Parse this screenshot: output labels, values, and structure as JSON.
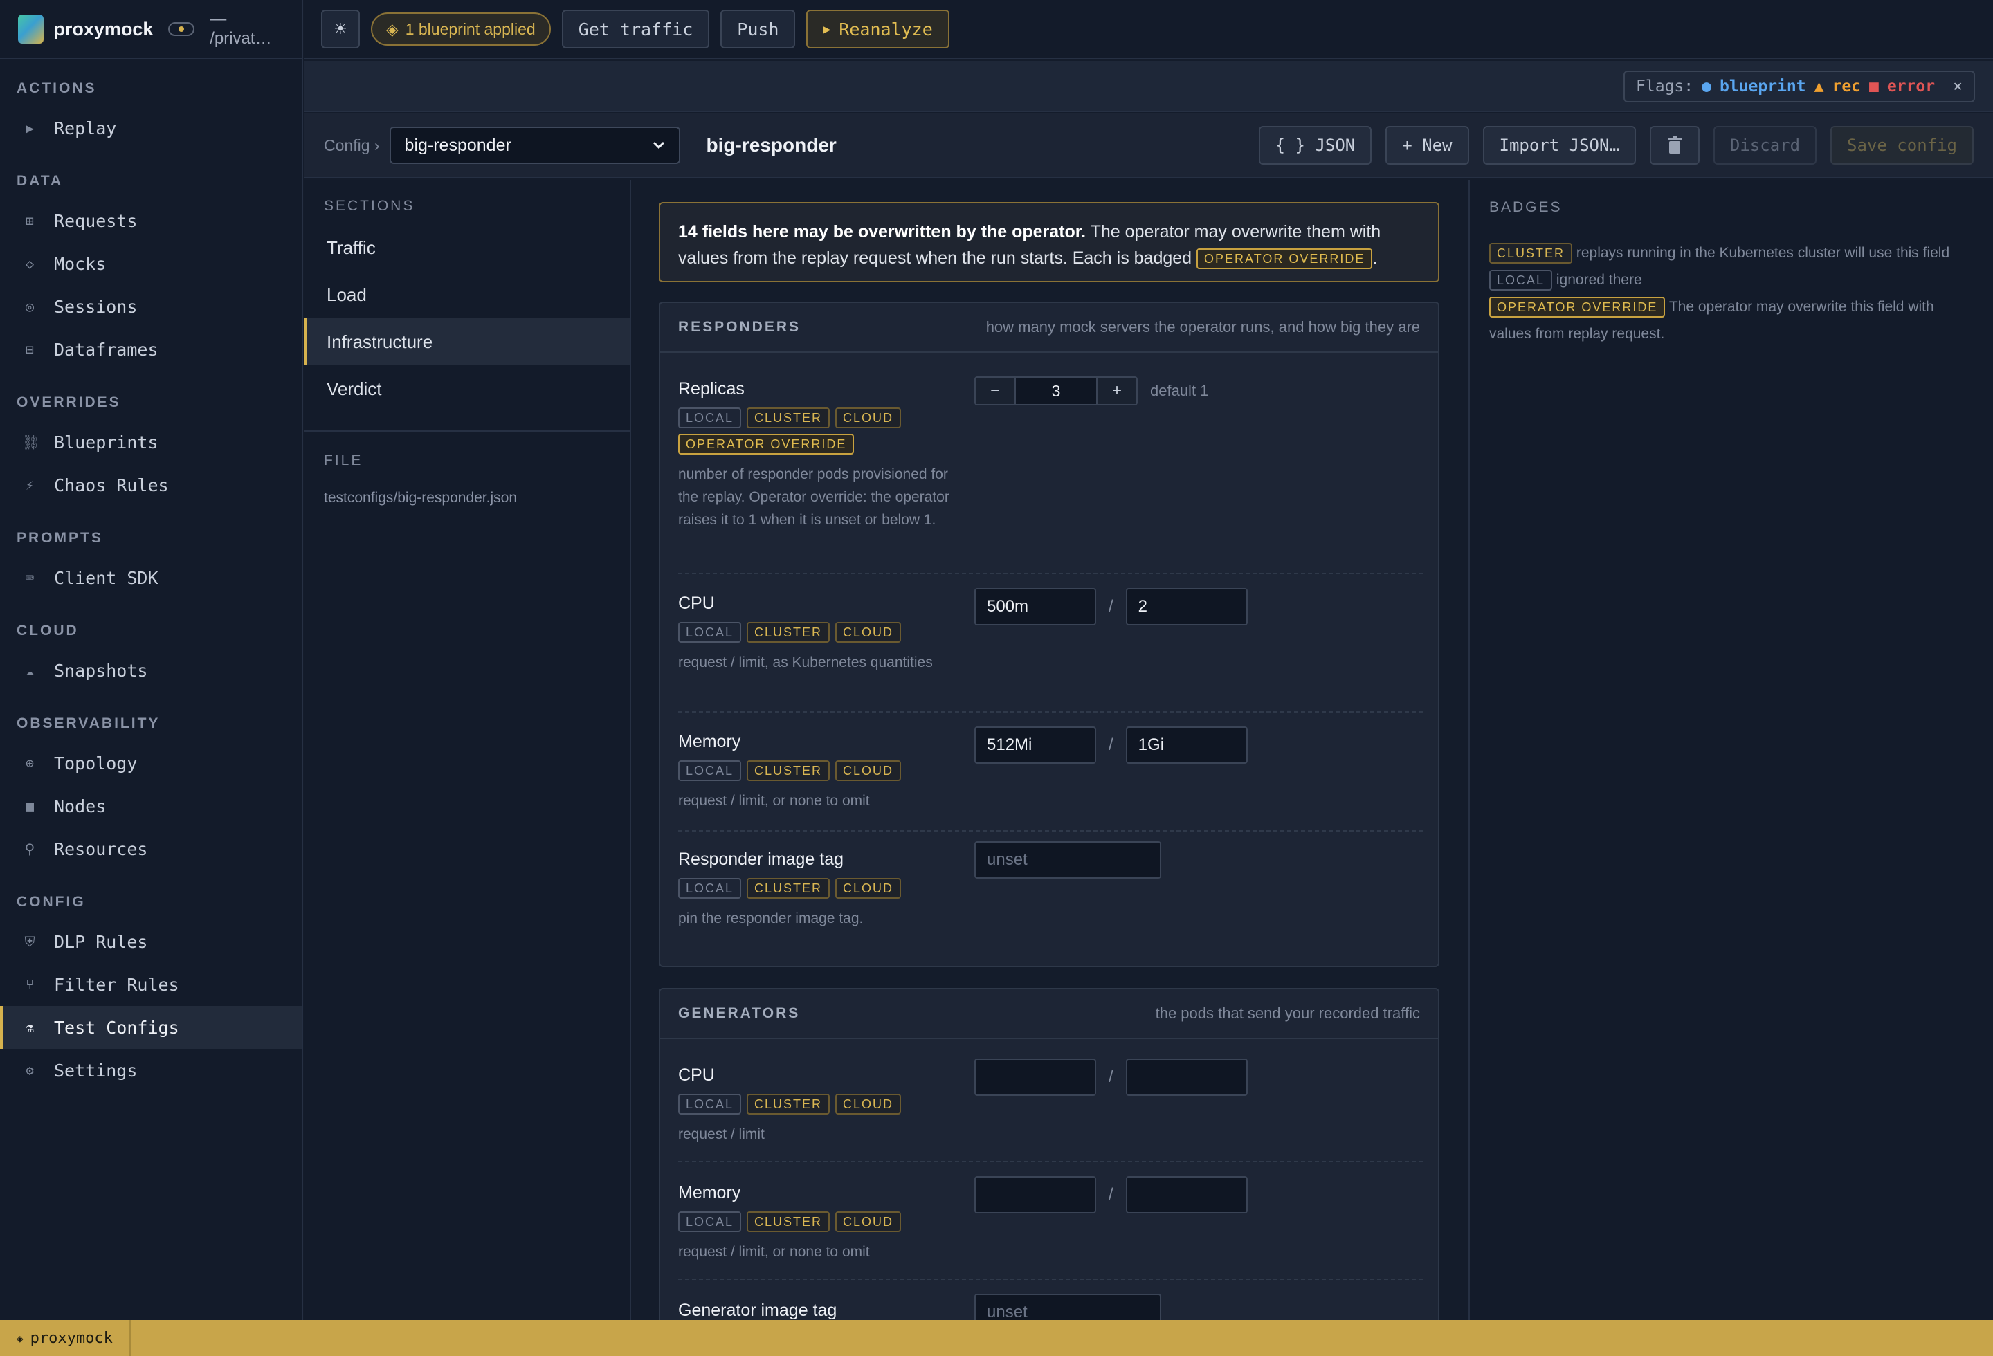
{
  "sidebar": {
    "brand_name": "proxymock",
    "brand_path": "— /privat…",
    "sections": [
      {
        "title": "ACTIONS",
        "items": [
          {
            "label": "Replay",
            "icon": "play-icon"
          }
        ]
      },
      {
        "title": "DATA",
        "items": [
          {
            "label": "Requests",
            "icon": "grid-icon"
          },
          {
            "label": "Mocks",
            "icon": "diamond-icon"
          },
          {
            "label": "Sessions",
            "icon": "target-icon"
          },
          {
            "label": "Dataframes",
            "icon": "table-icon"
          }
        ]
      },
      {
        "title": "OVERRIDES",
        "items": [
          {
            "label": "Blueprints",
            "icon": "link-icon"
          },
          {
            "label": "Chaos Rules",
            "icon": "bolt-icon"
          }
        ]
      },
      {
        "title": "PROMPTS",
        "items": [
          {
            "label": "Client SDK",
            "icon": "keyboard-icon"
          }
        ]
      },
      {
        "title": "CLOUD",
        "items": [
          {
            "label": "Snapshots",
            "icon": "cloud-icon"
          }
        ]
      },
      {
        "title": "OBSERVABILITY",
        "items": [
          {
            "label": "Topology",
            "icon": "globe-icon"
          },
          {
            "label": "Nodes",
            "icon": "square-icon"
          },
          {
            "label": "Resources",
            "icon": "wrench-icon"
          }
        ]
      },
      {
        "title": "CONFIG",
        "items": [
          {
            "label": "DLP Rules",
            "icon": "shield-icon"
          },
          {
            "label": "Filter Rules",
            "icon": "funnel-icon"
          },
          {
            "label": "Test Configs",
            "icon": "flask-icon",
            "active": true
          },
          {
            "label": "Settings",
            "icon": "gear-icon"
          }
        ]
      }
    ]
  },
  "topbar": {
    "theme_icon": "☀",
    "blueprint_pill": "1 blueprint applied",
    "get_traffic": "Get traffic",
    "push": "Push",
    "reanalyze": "Reanalyze"
  },
  "flags": {
    "label": "Flags:",
    "blueprint": "blueprint",
    "rec": "rec",
    "error": "error",
    "close": "×"
  },
  "config": {
    "label": "Config ›",
    "selected": "big-responder",
    "title": "big-responder",
    "json_btn": "{ } JSON",
    "new_btn": "+ New",
    "import_btn": "Import JSON…",
    "discard_btn": "Discard",
    "save_btn": "Save config"
  },
  "sections_panel": {
    "title": "SECTIONS",
    "items": [
      "Traffic",
      "Load",
      "Infrastructure",
      "Verdict"
    ],
    "active_index": 2,
    "file_title": "FILE",
    "file_path": "testconfigs/big-responder.json"
  },
  "notice": {
    "bold": "14 fields here may be overwritten by the operator.",
    "text": " The operator may overwrite them with values from the replay request when the run starts. Each is badged ",
    "badge": "OPERATOR OVERRIDE",
    "end": "."
  },
  "badges": {
    "local": "LOCAL",
    "cluster": "CLUSTER",
    "cloud": "CLOUD",
    "override": "OPERATOR OVERRIDE"
  },
  "responders": {
    "title": "RESPONDERS",
    "subtitle": "how many mock servers the operator runs, and how big they are",
    "replicas": {
      "label": "Replicas",
      "value": "3",
      "minus": "−",
      "plus": "+",
      "hint": "default 1",
      "desc": "number of responder pods provisioned for the replay. Operator override: the operator raises it to 1 when it is unset or below 1."
    },
    "cpu": {
      "label": "CPU",
      "request": "500m",
      "limit": "2",
      "desc": "request / limit, as Kubernetes quantities"
    },
    "memory": {
      "label": "Memory",
      "request": "512Mi",
      "limit": "1Gi",
      "desc": "request / limit, or none to omit"
    },
    "image": {
      "label": "Responder image tag",
      "placeholder": "unset",
      "desc": "pin the responder image tag."
    }
  },
  "generators": {
    "title": "GENERATORS",
    "subtitle": "the pods that send your recorded traffic",
    "cpu": {
      "label": "CPU",
      "desc": "request / limit"
    },
    "memory": {
      "label": "Memory",
      "desc": "request / limit, or none to omit"
    },
    "image": {
      "label": "Generator image tag",
      "placeholder": "unset"
    }
  },
  "slash": "/",
  "badges_panel": {
    "title": "BADGES",
    "cluster_text": "replays running in the Kubernetes cluster will use this field",
    "local_text": "ignored there",
    "override_text": "The operator may overwrite this field with values from replay request."
  },
  "statusbar": {
    "label": "proxymock"
  }
}
